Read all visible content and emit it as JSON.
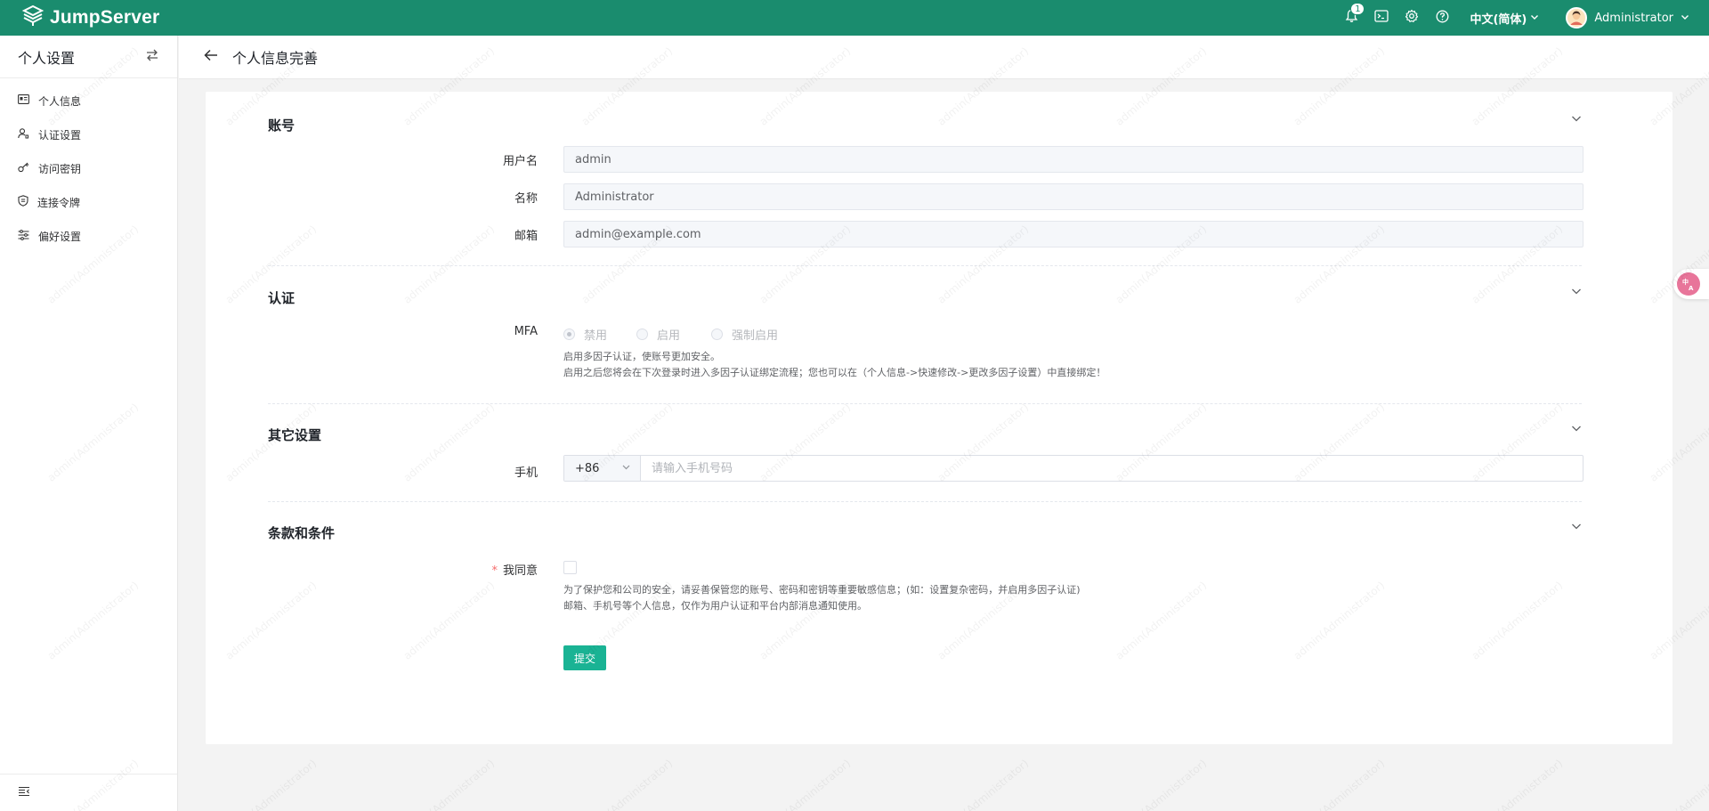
{
  "app": {
    "brand": "JumpServer",
    "notification_count": "1",
    "language": "中文(简体)",
    "user_name": "Administrator"
  },
  "sidebar": {
    "title": "个人设置",
    "items": [
      {
        "label": "个人信息",
        "icon": "id-card-icon"
      },
      {
        "label": "认证设置",
        "icon": "user-shield-icon"
      },
      {
        "label": "访问密钥",
        "icon": "key-icon"
      },
      {
        "label": "连接令牌",
        "icon": "token-icon"
      },
      {
        "label": "偏好设置",
        "icon": "sliders-icon"
      }
    ]
  },
  "page": {
    "title": "个人信息完善"
  },
  "sections": {
    "account": {
      "title": "账号",
      "username_label": "用户名",
      "username_value": "admin",
      "name_label": "名称",
      "name_value": "Administrator",
      "email_label": "邮箱",
      "email_value": "admin@example.com"
    },
    "auth": {
      "title": "认证",
      "mfa_label": "MFA",
      "options": [
        "禁用",
        "启用",
        "强制启用"
      ],
      "selected": "禁用",
      "help_line1": "启用多因子认证，使账号更加安全。",
      "help_line2": "启用之后您将会在下次登录时进入多因子认证绑定流程；您也可以在（个人信息->快速修改->更改多因子设置）中直接绑定！"
    },
    "other": {
      "title": "其它设置",
      "phone_label": "手机",
      "phone_prefix": "+86",
      "phone_placeholder": "请输入手机号码"
    },
    "terms": {
      "title": "条款和条件",
      "required_mark": "*",
      "agree_label": "我同意",
      "agree_checked": false,
      "help_line1": "为了保护您和公司的安全，请妥善保管您的账号、密码和密钥等重要敏感信息；(如：设置复杂密码，并启用多因子认证)",
      "help_line2": "邮箱、手机号等个人信息，仅作为用户认证和平台内部消息通知使用。"
    }
  },
  "actions": {
    "submit_label": "提交"
  },
  "watermark_text": "admin(Administrator)",
  "translate_button": "中\nA",
  "colors": {
    "brand": "#1a8c6e",
    "primary_button": "#1ab394"
  }
}
